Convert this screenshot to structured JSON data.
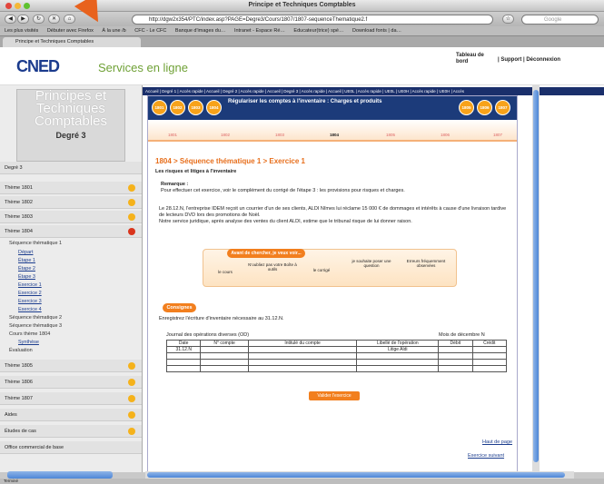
{
  "window": {
    "title": "Principe et Techniques Comptables"
  },
  "browser": {
    "url": "http://dgw2x354/PTC/index.asp?PAGE=Degre3/Cours/1807/1807-sequenceThematique2.f",
    "search_placeholder": "Google",
    "bookmarks": [
      "Les plus visités",
      "Débuter avec Firefox",
      "À la une /b",
      "CFC - Le CFC",
      "Banque d'images du…",
      "Intranet - Espace Ré…",
      "Educateur(trice) spé…",
      "Download fonts | da…"
    ],
    "tab_label": "Principe et Techniques Comptables",
    "status": "Terminé"
  },
  "header": {
    "logo": "CNED",
    "services": "Services en ligne",
    "tableau": "Tableau de bord",
    "links": "| Support | Déconnexion"
  },
  "sidebar": {
    "title_lines": [
      "Principes et",
      "Techniques",
      "Comptables"
    ],
    "degree": "Degré 3",
    "top_link": "Degré 3",
    "themes": [
      "Thème 1801",
      "Thème 1802",
      "Thème 1803",
      "Thème 1804"
    ],
    "sequence": "Séquence thématique 1",
    "sub_items": [
      "Départ",
      "Étape 1",
      "Étape 2",
      "Étape 3",
      "Exercice 1",
      "Exercice 2",
      "Exercice 3",
      "Exercice 4"
    ],
    "more_items": [
      "Séquence thématique 2",
      "Séquence thématique 3",
      "Cours thème 1804",
      "Synthèse",
      "Évaluation"
    ],
    "bottom_themes": [
      "Thème 1805",
      "Thème 1806",
      "Thème 1807",
      "Aides",
      "Études de cas",
      "Office commercial de base"
    ]
  },
  "topnav": "Accueil | Degré 1 | Accès rapide | Accueil | Degré 2 | Accès rapide | Accueil | Degré 3 | Accès rapide | Accueil | UE0L | Accès rapide | UE0L | UE0H | Accès rapide | UE0H | Accès",
  "banner": {
    "coins_left": [
      "1801",
      "1802",
      "1803",
      "1804"
    ],
    "coins_right": [
      "1805",
      "1806",
      "1807"
    ],
    "text": "Régulariser les comptes à l'inventaire : Charges et produits"
  },
  "timeline": [
    "1801",
    "1802",
    "1803",
    "1804",
    "1805",
    "1806",
    "1807"
  ],
  "content": {
    "title": "1804 > Séquence thématique 1 > Exercice 1",
    "subtitle": "Les risques et litiges à l'inventaire",
    "remarque_label": "Remarque :",
    "remarque_text": "Pour effectuer cet exercice, voir le complément du corrigé de l'étape 3 : les provisions pour risques et charges.",
    "paragraph1": "Le 28.12.N, l'entreprise IDEM reçoit un courrier d'un de ses clients, ALDI Nîmes lui réclame 15 000 € de dommages et intérêts à cause d'une livraison tardive de lecteurs DVD lors des promotions de Noël.",
    "paragraph2": "Notre service juridique, après analyse des ventes du client ALDI, estime que le tribunal risque de lui donner raison.",
    "hint_button": "Avant de chercher, je veux voir...",
    "hint_labels": [
      "le cours",
      "N'oubliez pas votre Boîte à outils",
      "le corrigé",
      "je souhaite poser une question",
      "Erreurs fréquemment observées"
    ],
    "consignes": "Consignes",
    "instruction": "Enregistrez l'écriture d'inventaire nécessaire au 31.12.N.",
    "journal_title": "Journal des opérations diverses (OD)",
    "journal_month": "Mois de décembre N",
    "table_headers": [
      "Date",
      "N° compte",
      "Intitulé du compte",
      "Libellé de l'opération",
      "Débit",
      "Crédit"
    ],
    "row_date": "31.12.N",
    "row_libelle": "Litige Aldi",
    "validate": "Valider l'exercice",
    "top_link": "Haut de page",
    "next_link": "Exercice suivant"
  },
  "colors": {
    "accent": "#f27f1e",
    "navy": "#1c3b7a",
    "link": "#1c3d8e"
  }
}
